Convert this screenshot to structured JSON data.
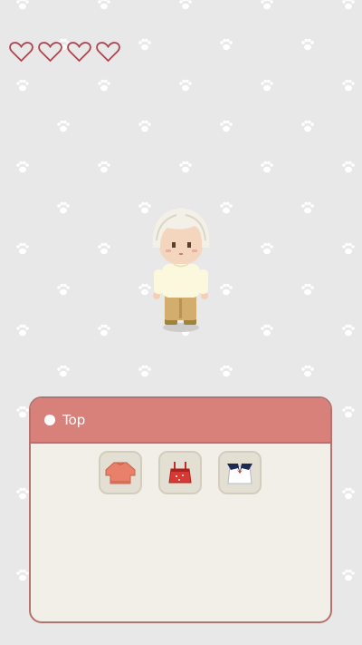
{
  "hud": {
    "hearts": 4
  },
  "wardrobe": {
    "category": "Top",
    "items": [
      {
        "icon": "sweater-icon",
        "color": "#e8806a"
      },
      {
        "icon": "tank-top-icon",
        "color": "#d83a33"
      },
      {
        "icon": "sailor-shirt-icon",
        "color": "#ffffff"
      }
    ]
  },
  "colors": {
    "background": "#e9e8e9",
    "paw": "#ffffff",
    "heart_outline": "#b0444a",
    "panel_header": "#d8817b",
    "panel_body": "#f2efe8",
    "panel_border": "#b5736f"
  }
}
